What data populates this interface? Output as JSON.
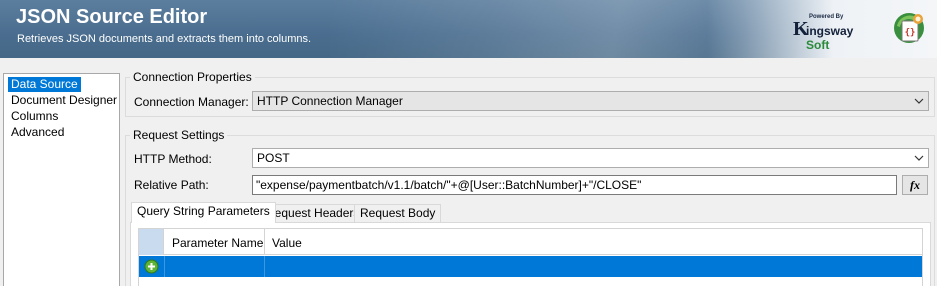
{
  "header": {
    "title": "JSON Source Editor",
    "subtitle": "Retrieves JSON documents and extracts them into columns.",
    "brand": {
      "powered_by": "Powered By",
      "k_letter": "K",
      "name_part1": "ingsway",
      "name_part2": "Soft"
    },
    "icon": "json-source-icon"
  },
  "nav": {
    "items": [
      {
        "label": "Data Source",
        "selected": true
      },
      {
        "label": "Document Designer",
        "selected": false
      },
      {
        "label": "Columns",
        "selected": false
      },
      {
        "label": "Advanced",
        "selected": false
      }
    ]
  },
  "connection": {
    "group_title": "Connection Properties",
    "manager_label": "Connection Manager:",
    "manager_value": "HTTP Connection Manager"
  },
  "request": {
    "group_title": "Request Settings",
    "method_label": "HTTP Method:",
    "method_value": "POST",
    "path_label": "Relative Path:",
    "path_value": "\"expense/paymentbatch/v1.1/batch/\"+@[User::BatchNumber]+\"/CLOSE\"",
    "fx_label": "fx"
  },
  "tabs": [
    {
      "label": "Query String Parameters",
      "active": true
    },
    {
      "label": "Request Headers",
      "active": false
    },
    {
      "label": "Request Body",
      "active": false
    }
  ],
  "grid": {
    "columns": [
      "Parameter Name",
      "Value"
    ],
    "new_row_icon": "add-row-icon"
  },
  "colors": {
    "selection": "#0078d7",
    "banner": "#4a6d8f",
    "brand_green": "#2a8a3a"
  }
}
